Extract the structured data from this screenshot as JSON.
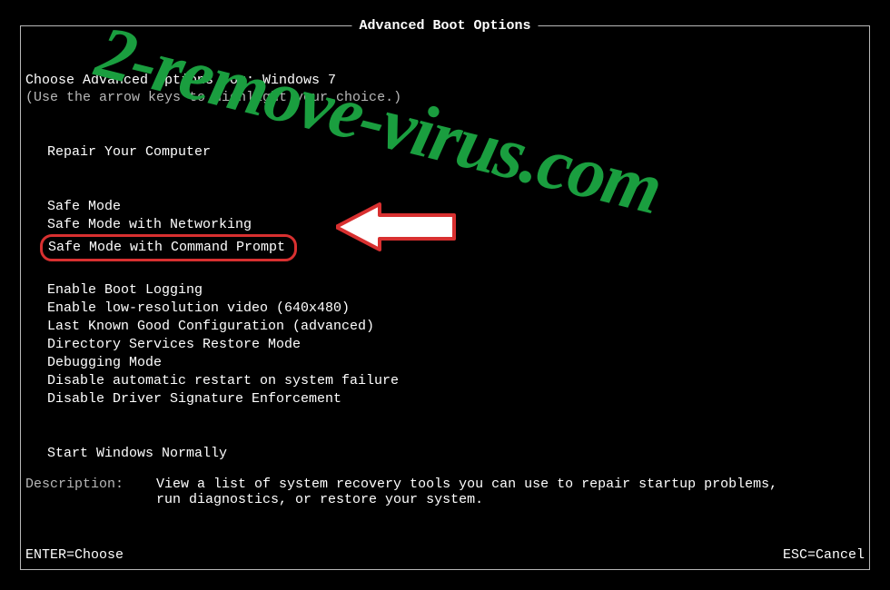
{
  "title": "Advanced Boot Options",
  "subtitle": "Choose Advanced Options for: Windows 7",
  "hint": "(Use the arrow keys to highlight your choice.)",
  "menu": {
    "repair": "Repair Your Computer",
    "group1": [
      "Safe Mode",
      "Safe Mode with Networking",
      "Safe Mode with Command Prompt"
    ],
    "group2": [
      "Enable Boot Logging",
      "Enable low-resolution video (640x480)",
      "Last Known Good Configuration (advanced)",
      "Directory Services Restore Mode",
      "Debugging Mode",
      "Disable automatic restart on system failure",
      "Disable Driver Signature Enforcement"
    ],
    "group3": [
      "Start Windows Normally"
    ]
  },
  "description": {
    "label": "Description:",
    "text": "View a list of system recovery tools you can use to repair startup problems, run diagnostics, or restore your system."
  },
  "footer": {
    "left": "ENTER=Choose",
    "right": "ESC=Cancel"
  },
  "watermark": "2-remove-virus.com",
  "highlight_color": "#d83030"
}
